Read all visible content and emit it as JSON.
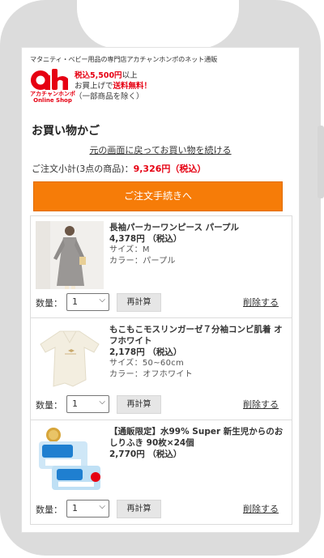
{
  "header": {
    "tagline": "マタニティ・ベビー用品の専門店アカチャンホンポのネット通販",
    "logo_mark": "ah",
    "logo_jp": "アカチャンホンポ",
    "logo_en": "Online Shop",
    "shipping_amount": "税込5,500円",
    "shipping_suffix": "以上",
    "shipping_line2_prefix": "お買上げで",
    "shipping_free": "送料無料！",
    "shipping_line3": "（一部商品を除く）"
  },
  "cart": {
    "title": "お買い物かご",
    "back_link": "元の画面に戻ってお買い物を続ける",
    "subtotal_label": "ご注文小計(3点の商品)：",
    "subtotal_amount": "9,326円（税込）",
    "checkout_label": "ご注文手続きへ",
    "qty_label": "数量：",
    "recalc_label": "再計算",
    "delete_label": "削除する",
    "items": [
      {
        "name": "長袖パーカーワンピース パープル",
        "price": "4,378円 （税込）",
        "size": "サイズ：M",
        "color": "カラー：パープル",
        "qty": "1",
        "image": "dress-photo"
      },
      {
        "name": "もこもこモスリンガーゼ７分袖コンビ肌着 オフホワイト",
        "price": "2,178円 （税込）",
        "size": "サイズ：50~60cm",
        "color": "カラー：オフホワイト",
        "qty": "1",
        "image": "baby-garment-photo"
      },
      {
        "name": "【通販限定】水99% Super 新生児からのおしりふき 90枚×24個",
        "price": "2,770円 （税込）",
        "qty": "1",
        "image": "wipes-photo"
      }
    ]
  },
  "colors": {
    "accent": "#f67c08",
    "brand_red": "#e60012",
    "frame": "#dcdcdc"
  }
}
